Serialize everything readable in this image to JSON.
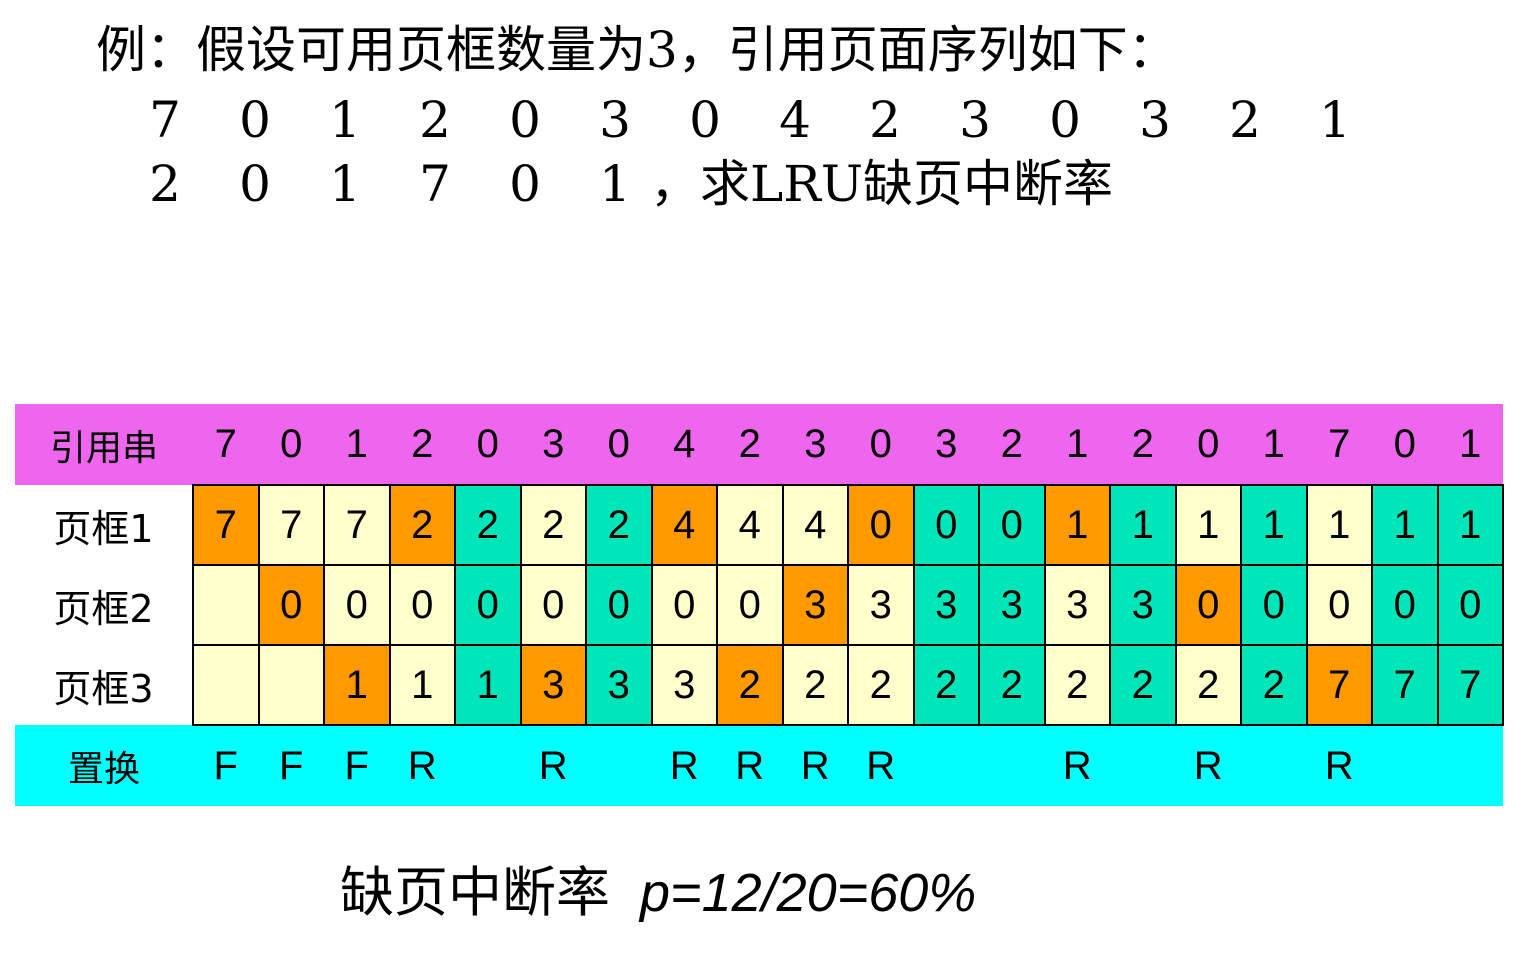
{
  "problem": {
    "line1": "例：假设可用页框数量为3，引用页面序列如下：",
    "line2": [
      "7",
      "0",
      "1",
      "2",
      "0",
      "3",
      "0",
      "4",
      "2",
      "3",
      "0",
      "3",
      "2",
      "1"
    ],
    "line3": [
      "2",
      "0",
      "1",
      "7",
      "0",
      "1",
      "，求LRU缺页中断率"
    ]
  },
  "table": {
    "ref_label": "引用串",
    "refs": [
      "7",
      "0",
      "1",
      "2",
      "0",
      "3",
      "0",
      "4",
      "2",
      "3",
      "0",
      "3",
      "2",
      "1",
      "2",
      "0",
      "1",
      "7",
      "0",
      "1"
    ],
    "frames": [
      {
        "label": "页框1",
        "cells": [
          {
            "v": "7",
            "s": "fault"
          },
          {
            "v": "7",
            "s": "keep"
          },
          {
            "v": "7",
            "s": "keep"
          },
          {
            "v": "2",
            "s": "fault"
          },
          {
            "v": "2",
            "s": "hit"
          },
          {
            "v": "2",
            "s": "keep"
          },
          {
            "v": "2",
            "s": "hit"
          },
          {
            "v": "4",
            "s": "fault"
          },
          {
            "v": "4",
            "s": "keep"
          },
          {
            "v": "4",
            "s": "keep"
          },
          {
            "v": "0",
            "s": "fault"
          },
          {
            "v": "0",
            "s": "hit"
          },
          {
            "v": "0",
            "s": "hit"
          },
          {
            "v": "1",
            "s": "fault"
          },
          {
            "v": "1",
            "s": "hit"
          },
          {
            "v": "1",
            "s": "keep"
          },
          {
            "v": "1",
            "s": "hit"
          },
          {
            "v": "1",
            "s": "keep"
          },
          {
            "v": "1",
            "s": "hit"
          },
          {
            "v": "1",
            "s": "hit"
          }
        ]
      },
      {
        "label": "页框2",
        "cells": [
          {
            "v": "",
            "s": "empty"
          },
          {
            "v": "0",
            "s": "fault"
          },
          {
            "v": "0",
            "s": "keep"
          },
          {
            "v": "0",
            "s": "keep"
          },
          {
            "v": "0",
            "s": "hit"
          },
          {
            "v": "0",
            "s": "keep"
          },
          {
            "v": "0",
            "s": "hit"
          },
          {
            "v": "0",
            "s": "keep"
          },
          {
            "v": "0",
            "s": "keep"
          },
          {
            "v": "3",
            "s": "fault"
          },
          {
            "v": "3",
            "s": "keep"
          },
          {
            "v": "3",
            "s": "hit"
          },
          {
            "v": "3",
            "s": "hit"
          },
          {
            "v": "3",
            "s": "keep"
          },
          {
            "v": "3",
            "s": "hit"
          },
          {
            "v": "0",
            "s": "fault"
          },
          {
            "v": "0",
            "s": "hit"
          },
          {
            "v": "0",
            "s": "keep"
          },
          {
            "v": "0",
            "s": "hit"
          },
          {
            "v": "0",
            "s": "hit"
          }
        ]
      },
      {
        "label": "页框3",
        "cells": [
          {
            "v": "",
            "s": "empty"
          },
          {
            "v": "",
            "s": "empty"
          },
          {
            "v": "1",
            "s": "fault"
          },
          {
            "v": "1",
            "s": "keep"
          },
          {
            "v": "1",
            "s": "hit"
          },
          {
            "v": "3",
            "s": "fault"
          },
          {
            "v": "3",
            "s": "hit"
          },
          {
            "v": "3",
            "s": "keep"
          },
          {
            "v": "2",
            "s": "fault"
          },
          {
            "v": "2",
            "s": "keep"
          },
          {
            "v": "2",
            "s": "keep"
          },
          {
            "v": "2",
            "s": "hit"
          },
          {
            "v": "2",
            "s": "hit"
          },
          {
            "v": "2",
            "s": "keep"
          },
          {
            "v": "2",
            "s": "hit"
          },
          {
            "v": "2",
            "s": "keep"
          },
          {
            "v": "2",
            "s": "hit"
          },
          {
            "v": "7",
            "s": "fault"
          },
          {
            "v": "7",
            "s": "hit"
          },
          {
            "v": "7",
            "s": "hit"
          }
        ]
      }
    ],
    "replace_label": "置换",
    "replacements": [
      "F",
      "F",
      "F",
      "R",
      "",
      "R",
      "",
      "R",
      "R",
      "R",
      "R",
      "",
      "",
      "R",
      "",
      "R",
      "",
      "R",
      "",
      ""
    ]
  },
  "colors": {
    "ref_row": "#ee66ee",
    "replace_row": "#00ffff",
    "fault": "#ff9900",
    "hit": "#00e6b8",
    "keep": "#ffffcc"
  },
  "result": {
    "label": "缺页中断率",
    "formula": "p=12/20=60%"
  }
}
